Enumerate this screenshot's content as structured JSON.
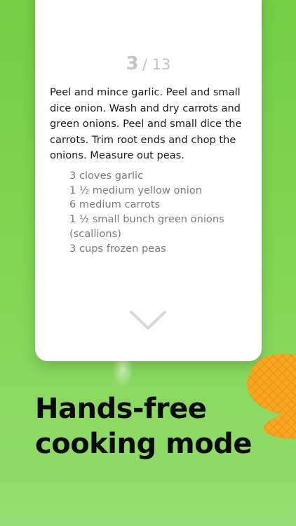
{
  "step": {
    "current": "3",
    "total": "/ 13"
  },
  "instructions": "Peel and mince garlic. Peel and small dice onion. Wash and dry carrots and green onions. Peel and small dice the carrots. Trim root ends and chop the onions. Measure out peas.",
  "ingredients": [
    "3 cloves garlic",
    "1 ½ medium yellow onion",
    "6 medium carrots",
    "1 ½ small bunch green onions (scallions)",
    "3 cups frozen peas"
  ],
  "headline": {
    "line1": "Hands-free",
    "line2": "cooking mode"
  },
  "icons": {
    "next": "chevron-down-icon",
    "decoration": "waffle-icon"
  },
  "colors": {
    "background": "#7fd44d",
    "card": "#ffffff",
    "waffle": "#f7a620"
  }
}
